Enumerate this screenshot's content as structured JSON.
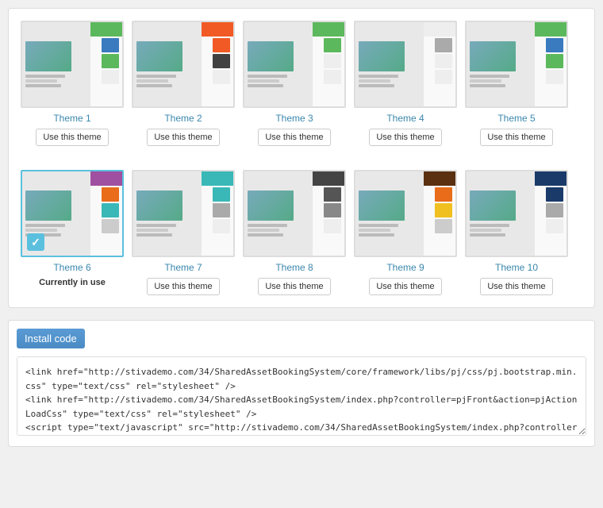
{
  "themes": [
    {
      "id": 1,
      "name": "Theme 1",
      "button_label": "Use this theme",
      "active": false,
      "header_class": "t1-header",
      "swatch1_class": "t1-s1",
      "swatch2_class": "t1-s2",
      "swatch3_class": "t1-s3"
    },
    {
      "id": 2,
      "name": "Theme 2",
      "button_label": "Use this theme",
      "active": false,
      "header_class": "t2-header",
      "swatch1_class": "t2-s1",
      "swatch2_class": "t2-s2",
      "swatch3_class": "t2-s3"
    },
    {
      "id": 3,
      "name": "Theme 3",
      "button_label": "Use this theme",
      "active": false,
      "header_class": "t3-header",
      "swatch1_class": "t3-s1",
      "swatch2_class": "t3-s2",
      "swatch3_class": "t3-s3"
    },
    {
      "id": 4,
      "name": "Theme 4",
      "button_label": "Use this theme",
      "active": false,
      "header_class": "t4-header",
      "swatch1_class": "t4-s1",
      "swatch2_class": "t4-s2",
      "swatch3_class": "t4-s3"
    },
    {
      "id": 5,
      "name": "Theme 5",
      "button_label": "Use this theme",
      "active": false,
      "header_class": "t5-header",
      "swatch1_class": "t5-s1",
      "swatch2_class": "t5-s2",
      "swatch3_class": "t5-s3"
    },
    {
      "id": 6,
      "name": "Theme 6",
      "button_label": "Currently in use",
      "active": true,
      "header_class": "t6-header",
      "swatch1_class": "t6-s1",
      "swatch2_class": "t6-s2",
      "swatch3_class": "t6-s3"
    },
    {
      "id": 7,
      "name": "Theme 7",
      "button_label": "Use this theme",
      "active": false,
      "header_class": "t7-header",
      "swatch1_class": "t7-s1",
      "swatch2_class": "t7-s2",
      "swatch3_class": "t7-s3"
    },
    {
      "id": 8,
      "name": "Theme 8",
      "button_label": "Use this theme",
      "active": false,
      "header_class": "t8-header",
      "swatch1_class": "t8-s1",
      "swatch2_class": "t8-s2",
      "swatch3_class": "t8-s3"
    },
    {
      "id": 9,
      "name": "Theme 9",
      "button_label": "Use this theme",
      "active": false,
      "header_class": "t9-header",
      "swatch1_class": "t9-s1",
      "swatch2_class": "t9-s2",
      "swatch3_class": "t9-s3"
    },
    {
      "id": 10,
      "name": "Theme 10",
      "button_label": "Use this theme",
      "active": false,
      "header_class": "t10-header",
      "swatch1_class": "t10-s1",
      "swatch2_class": "t10-s2",
      "swatch3_class": "t10-s3"
    }
  ],
  "install_code": {
    "title": "Install code",
    "code": "<link href=\"http://stivademo.com/34/SharedAssetBookingSystem/core/framework/libs/pj/css/pj.bootstrap.min.css\" type=\"text/css\" rel=\"stylesheet\" />\n<link href=\"http://stivademo.com/34/SharedAssetBookingSystem/index.php?controller=pjFront&action=pjActionLoadCss\" type=\"text/css\" rel=\"stylesheet\" />\n<script type=\"text/javascript\" src=\"http://stivademo.com/34/SharedAssetBookingSystem/index.php?controller=pjFront&action=pjActionLoad\"></script>"
  }
}
